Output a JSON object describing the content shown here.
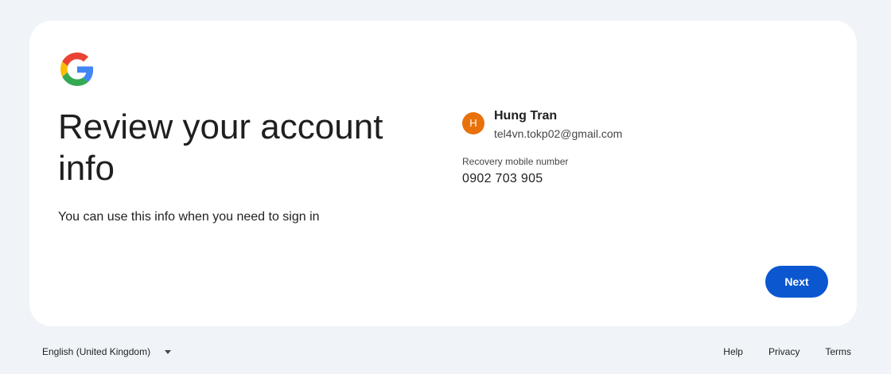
{
  "card": {
    "logo_icon": "google-g-logo-icon",
    "headline": "Review your account info",
    "subtext": "You can use this info when you need to sign in",
    "account": {
      "avatar_initial": "H",
      "avatar_color": "#e8710a",
      "name": "Hung Tran",
      "email": "tel4vn.tokp02@gmail.com"
    },
    "recovery": {
      "label": "Recovery mobile number",
      "value": "0902 703 905"
    },
    "next_label": "Next"
  },
  "footer": {
    "language": "English (United Kingdom)",
    "links": [
      "Help",
      "Privacy",
      "Terms"
    ]
  },
  "colors": {
    "background": "#f0f4f9",
    "accent": "#0b57d0"
  }
}
